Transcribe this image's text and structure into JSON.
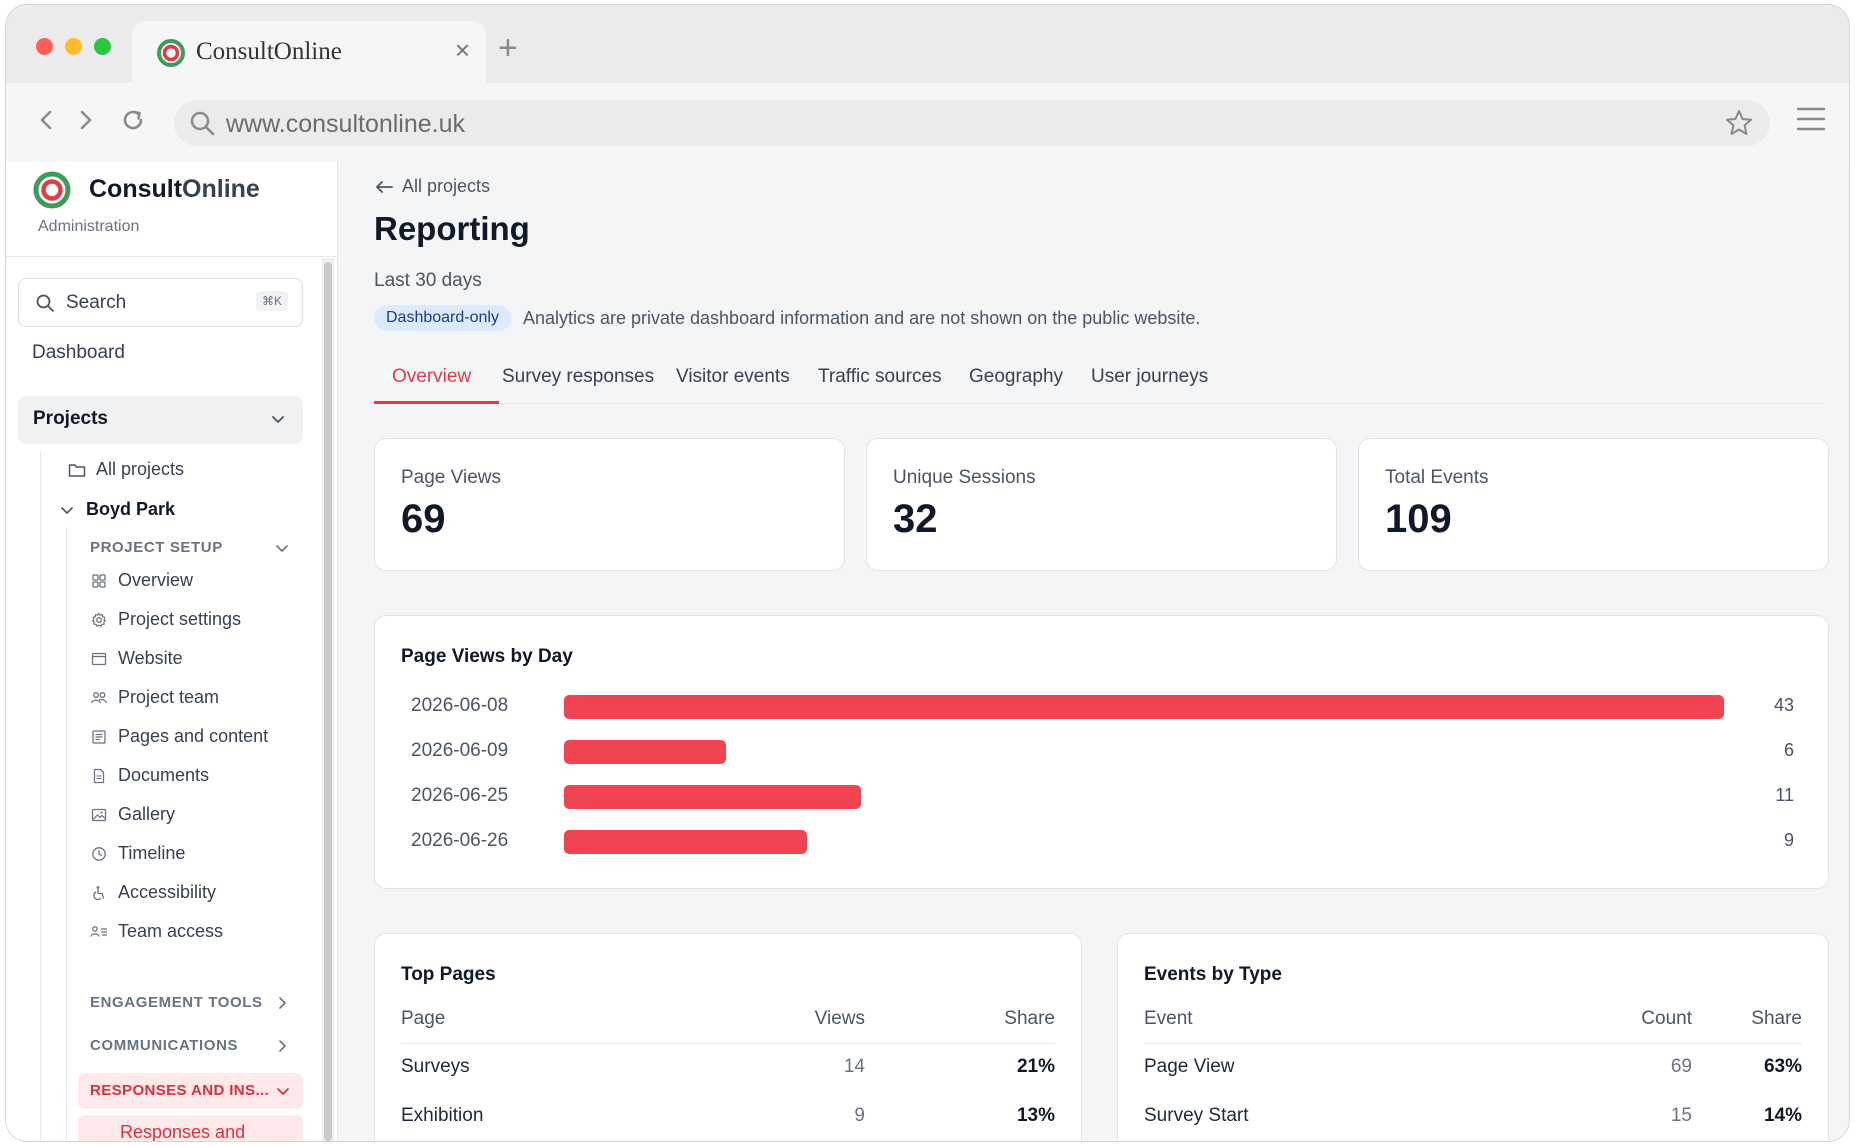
{
  "browser": {
    "tab_title": "ConsultOnline",
    "url": "www.consultonline.uk",
    "new_tab_label": "+",
    "close_label": "×"
  },
  "brand": {
    "name_a": "Consult",
    "name_b": "Online",
    "subtitle": "Administration",
    "colors": {
      "ring_outer": "#3f9b5a",
      "ring_inner": "#e23b48"
    }
  },
  "sidebar": {
    "search_label": "Search",
    "search_shortcut": "⌘K",
    "dashboard": "Dashboard",
    "projects": "Projects",
    "all_projects": "All projects",
    "project_name": "Boyd Park",
    "setup_header": "PROJECT SETUP",
    "setup_items": [
      {
        "label": "Overview",
        "icon": "grid-icon"
      },
      {
        "label": "Project settings",
        "icon": "gear-icon"
      },
      {
        "label": "Website",
        "icon": "browser-icon"
      },
      {
        "label": "Project team",
        "icon": "team-icon"
      },
      {
        "label": "Pages and content",
        "icon": "pages-icon"
      },
      {
        "label": "Documents",
        "icon": "document-icon"
      },
      {
        "label": "Gallery",
        "icon": "image-icon"
      },
      {
        "label": "Timeline",
        "icon": "clock-icon"
      },
      {
        "label": "Accessibility",
        "icon": "accessibility-icon"
      },
      {
        "label": "Team access",
        "icon": "user-list-icon"
      }
    ],
    "engagement_header": "ENGAGEMENT TOOLS",
    "communications_header": "COMMUNICATIONS",
    "responses_header": "RESPONSES AND INS...",
    "responses_item": "Responses and"
  },
  "page": {
    "back_label": "All projects",
    "title": "Reporting",
    "subtitle": "Last 30 days",
    "badge": "Dashboard-only",
    "notice": "Analytics are private dashboard information and are not shown on the public website.",
    "tabs": [
      "Overview",
      "Survey responses",
      "Visitor events",
      "Traffic sources",
      "Geography",
      "User journeys"
    ],
    "active_tab": "Overview",
    "accent_color": "#e23b48"
  },
  "stats": [
    {
      "label": "Page Views",
      "value": "69"
    },
    {
      "label": "Unique Sessions",
      "value": "32"
    },
    {
      "label": "Total Events",
      "value": "109"
    }
  ],
  "page_views_by_day": {
    "title": "Page Views by Day",
    "max": 43,
    "bar_color": "#f14452",
    "rows": [
      {
        "date": "2026-06-08",
        "value": 43
      },
      {
        "date": "2026-06-09",
        "value": 6
      },
      {
        "date": "2026-06-25",
        "value": 11
      },
      {
        "date": "2026-06-26",
        "value": 9
      }
    ]
  },
  "top_pages": {
    "title": "Top Pages",
    "columns": [
      "Page",
      "Views",
      "Share"
    ],
    "rows": [
      {
        "name": "Surveys",
        "count": "14",
        "share": "21%"
      },
      {
        "name": "Exhibition",
        "count": "9",
        "share": "13%"
      }
    ]
  },
  "events_by_type": {
    "title": "Events by Type",
    "columns": [
      "Event",
      "Count",
      "Share"
    ],
    "rows": [
      {
        "name": "Page View",
        "count": "69",
        "share": "63%"
      },
      {
        "name": "Survey Start",
        "count": "15",
        "share": "14%"
      }
    ]
  }
}
